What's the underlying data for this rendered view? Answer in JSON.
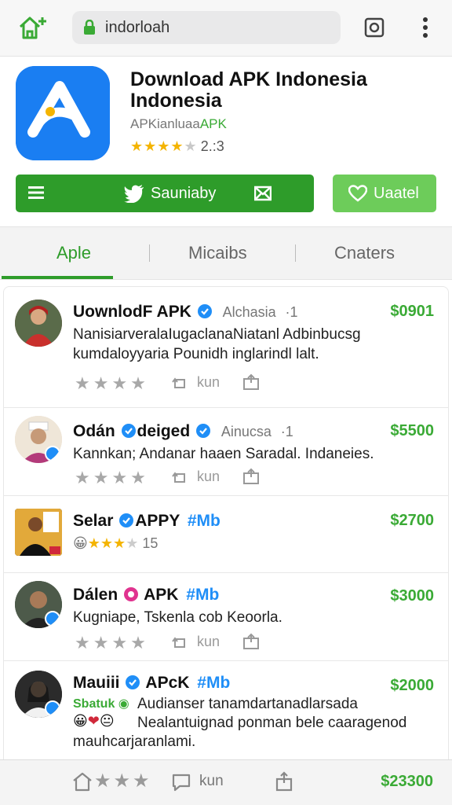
{
  "browser": {
    "url": "indorloah",
    "home_icon": "home-plus-icon",
    "tabs_icon": "tabs-icon",
    "more_icon": "more-vertical-icon"
  },
  "app": {
    "title": "Download APK Indonesia Indonesia",
    "subtitle_prefix": "APKianluaa",
    "subtitle_suffix": "APK",
    "rating_stars": 4,
    "rating_value": "2.:3",
    "download_label": "Sauniaby",
    "fav_label": "Uaatel",
    "accent_color": "#2e9c2a"
  },
  "tabs": [
    {
      "label": "Aple",
      "active": true
    },
    {
      "label": "Micaibs",
      "active": false
    },
    {
      "label": "Cnaters",
      "active": false
    }
  ],
  "posts": [
    {
      "name": "UownlodF APK",
      "meta": "Alchasia",
      "meta_icon": "·1",
      "price": "$0901",
      "text": "NanisiarveralaIugaclanaNiatanl Adbinbucsg kumdaloyyaria Pounidh inglarindl lalt.",
      "action_label": "kun"
    },
    {
      "name": "Odán",
      "name2": "deiged",
      "meta": "Ainucsa",
      "meta_icon": "·1",
      "price": "$5500",
      "text": "Kannkan; Andanar haaen Saradal. Indaneies.",
      "action_label": "kun"
    },
    {
      "name": "Selar",
      "name2": "APPY",
      "tag": "#Mb",
      "price": "$2700",
      "rating_count": "15"
    },
    {
      "name": "Dálen",
      "name2": "APK",
      "tag": "#Mb",
      "price": "$3000",
      "text": "Kugniape, Tskenla cob Keoorla.",
      "action_label": "kun"
    },
    {
      "name": "Mauiii",
      "name2": "APcK",
      "tag": "#Mb",
      "price": "$2000",
      "sub_label": "Sbatuk",
      "text1": "Audianser tanamdartanadlarsada",
      "text2": "Nealantuignad ponman bele caaragenod",
      "text3": "mauhcarjaranlami."
    }
  ],
  "bottom": {
    "action_label": "kun",
    "price": "$23300"
  }
}
